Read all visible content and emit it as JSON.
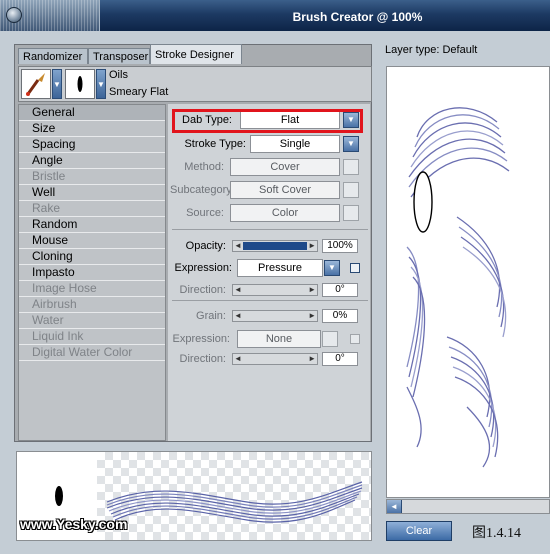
{
  "window": {
    "title": "Brush Creator @ 100%"
  },
  "tabs": [
    {
      "label": "Randomizer"
    },
    {
      "label": "Transposer"
    },
    {
      "label": "Stroke Designer",
      "active": true
    }
  ],
  "brush": {
    "category": "Oils",
    "variant": "Smeary Flat"
  },
  "categories": [
    {
      "label": "General",
      "selected": true
    },
    {
      "label": "Size"
    },
    {
      "label": "Spacing"
    },
    {
      "label": "Angle"
    },
    {
      "label": "Bristle",
      "disabled": true
    },
    {
      "label": "Well"
    },
    {
      "label": "Rake",
      "disabled": true
    },
    {
      "label": "Random"
    },
    {
      "label": "Mouse"
    },
    {
      "label": "Cloning"
    },
    {
      "label": "Impasto"
    },
    {
      "label": "Image Hose",
      "disabled": true
    },
    {
      "label": "Airbrush",
      "disabled": true
    },
    {
      "label": "Water",
      "disabled": true
    },
    {
      "label": "Liquid Ink",
      "disabled": true
    },
    {
      "label": "Digital Water Color",
      "disabled": true
    }
  ],
  "general": {
    "dab_type": {
      "label": "Dab Type:",
      "value": "Flat"
    },
    "stroke_type": {
      "label": "Stroke Type:",
      "value": "Single"
    },
    "method": {
      "label": "Method:",
      "value": "Cover"
    },
    "subcategory": {
      "label": "Subcategory:",
      "value": "Soft Cover"
    },
    "source": {
      "label": "Source:",
      "value": "Color"
    },
    "opacity": {
      "label": "Opacity:",
      "value": "100%",
      "level": 1.0
    },
    "expression1": {
      "label": "Expression:",
      "value": "Pressure"
    },
    "direction1": {
      "label": "Direction:",
      "value": "0°"
    },
    "grain": {
      "label": "Grain:",
      "value": "0%"
    },
    "expression2": {
      "label": "Expression:",
      "value": "None"
    },
    "direction2": {
      "label": "Direction:",
      "value": "0°"
    }
  },
  "preview": {
    "watermark": "www.Yesky.com",
    "stroke_color": "#5a63a8"
  },
  "right": {
    "layer_type": "Layer type: Default",
    "clear_label": "Clear",
    "figure_label": "图1.4.14"
  },
  "colors": {
    "highlight": "#e1141c",
    "stroke": "#5a5fa8"
  }
}
